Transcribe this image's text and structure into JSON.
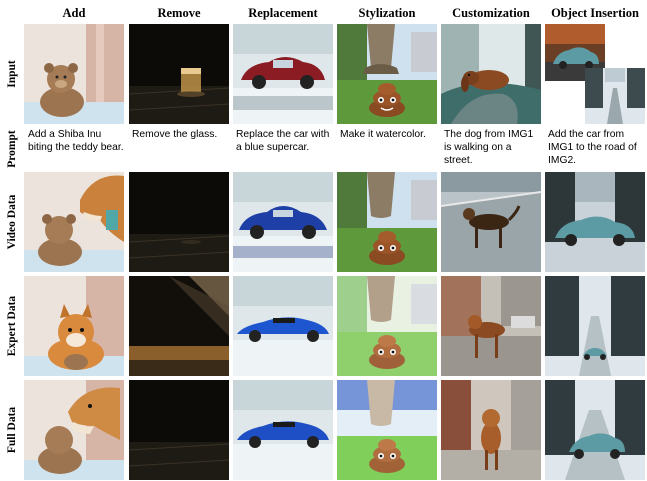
{
  "columns": [
    "Add",
    "Remove",
    "Replacement",
    "Stylization",
    "Customization",
    "Object Insertion"
  ],
  "rows": [
    "Input",
    "Prompt",
    "Video Data",
    "Expert Data",
    "Full Data"
  ],
  "prompts": [
    "Add a Shiba Inu biting the teddy bear.",
    "Remove the glass.",
    "Replace the car with a blue supercar.",
    "Make it watercolor.",
    "The dog from IMG1 is walking on a street.",
    "Add the car from IMG1 to the road of IMG2."
  ]
}
